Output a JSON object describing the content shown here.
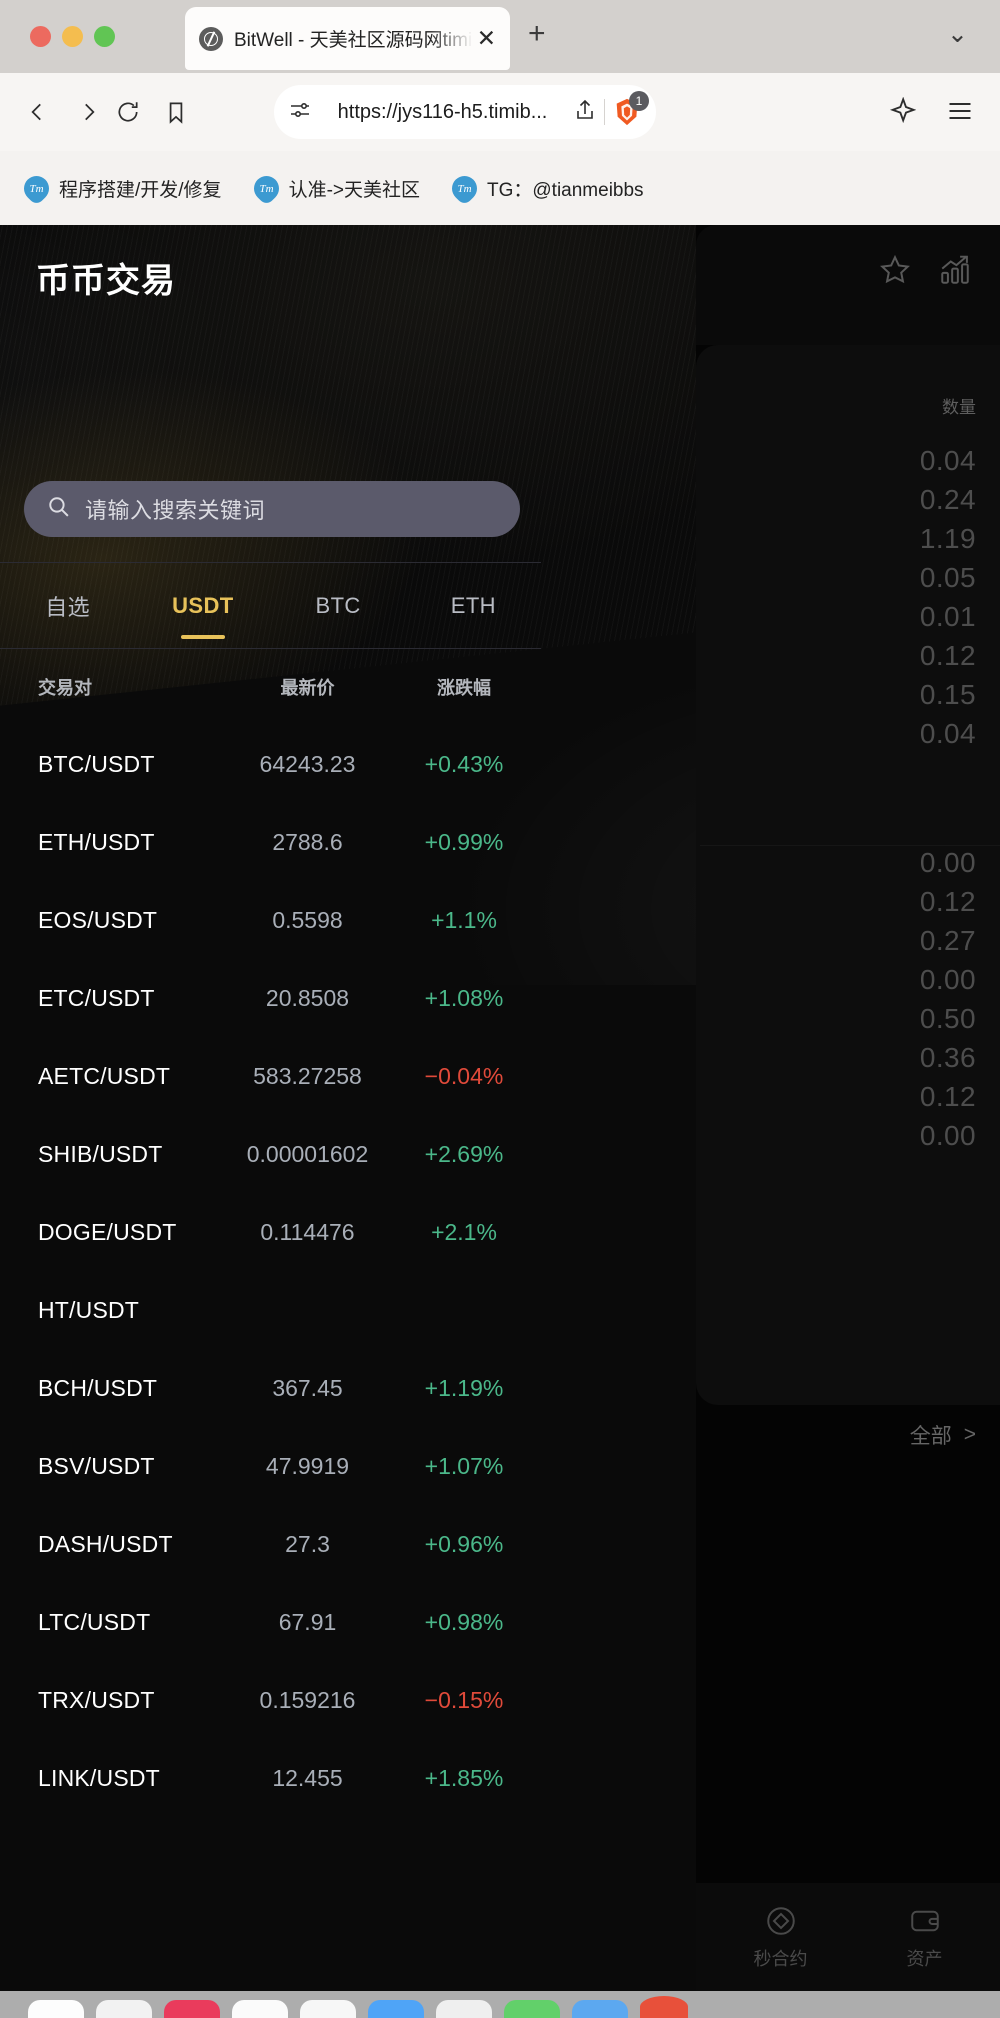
{
  "browser": {
    "tab": {
      "title": "BitWell - 天美社区源码网timib",
      "close_label": "✕",
      "favicon": "globe-icon"
    },
    "new_tab_label": "+",
    "tab_list_chevron": "⌄",
    "omnibox": {
      "url": "https://jys116-h5.timib...",
      "shield_count": "1"
    },
    "bookmarks": [
      {
        "label": "程序搭建/开发/修复",
        "icon": "tm-icon"
      },
      {
        "label": "认准->天美社区",
        "icon": "tm-icon"
      },
      {
        "label": "TG：@tianmeibbs",
        "icon": "tm-icon"
      }
    ]
  },
  "app": {
    "title": "币币交易",
    "header_actions": [
      {
        "name": "favorite-star-icon"
      },
      {
        "name": "market-chart-icon"
      }
    ],
    "search": {
      "placeholder": "请输入搜索关键词",
      "icon": "search-icon"
    },
    "tabs": [
      {
        "label": "自选",
        "active": false
      },
      {
        "label": "USDT",
        "active": true
      },
      {
        "label": "BTC",
        "active": false
      },
      {
        "label": "ETH",
        "active": false
      }
    ],
    "columns": {
      "pair": "交易对",
      "price": "最新价",
      "change": "涨跌幅"
    },
    "colors": {
      "accent": "#e8c25a",
      "up": "#4bb88a",
      "down": "#e04a3a"
    },
    "rows": [
      {
        "pair": "BTC/USDT",
        "price": "64243.23",
        "change": "+0.43%",
        "dir": "up"
      },
      {
        "pair": "ETH/USDT",
        "price": "2788.6",
        "change": "+0.99%",
        "dir": "up"
      },
      {
        "pair": "EOS/USDT",
        "price": "0.5598",
        "change": "+1.1%",
        "dir": "up"
      },
      {
        "pair": "ETC/USDT",
        "price": "20.8508",
        "change": "+1.08%",
        "dir": "up"
      },
      {
        "pair": "AETC/USDT",
        "price": "583.27258",
        "change": "−0.04%",
        "dir": "down"
      },
      {
        "pair": "SHIB/USDT",
        "price": "0.00001602",
        "change": "+2.69%",
        "dir": "up"
      },
      {
        "pair": "DOGE/USDT",
        "price": "0.114476",
        "change": "+2.1%",
        "dir": "up"
      },
      {
        "pair": "HT/USDT",
        "price": "",
        "change": "",
        "dir": "up"
      },
      {
        "pair": "BCH/USDT",
        "price": "367.45",
        "change": "+1.19%",
        "dir": "up"
      },
      {
        "pair": "BSV/USDT",
        "price": "47.9919",
        "change": "+1.07%",
        "dir": "up"
      },
      {
        "pair": "DASH/USDT",
        "price": "27.3",
        "change": "+0.96%",
        "dir": "up"
      },
      {
        "pair": "LTC/USDT",
        "price": "67.91",
        "change": "+0.98%",
        "dir": "up"
      },
      {
        "pair": "TRX/USDT",
        "price": "0.159216",
        "change": "−0.15%",
        "dir": "down"
      },
      {
        "pair": "LINK/USDT",
        "price": "12.455",
        "change": "+1.85%",
        "dir": "up"
      }
    ]
  },
  "background": {
    "qty_header": "数量",
    "qty_group_a": [
      "0.04",
      "0.24",
      "1.19",
      "0.05",
      "0.01",
      "0.12",
      "0.15",
      "0.04"
    ],
    "qty_group_b": [
      "0.00",
      "0.12",
      "0.27",
      "0.00",
      "0.50",
      "0.36",
      "0.12",
      "0.00"
    ],
    "all_label": "全部",
    "all_chevron": ">",
    "bottom_nav": [
      {
        "label": "秒合约",
        "icon": "contract-icon"
      },
      {
        "label": "资产",
        "icon": "wallet-icon"
      }
    ]
  }
}
